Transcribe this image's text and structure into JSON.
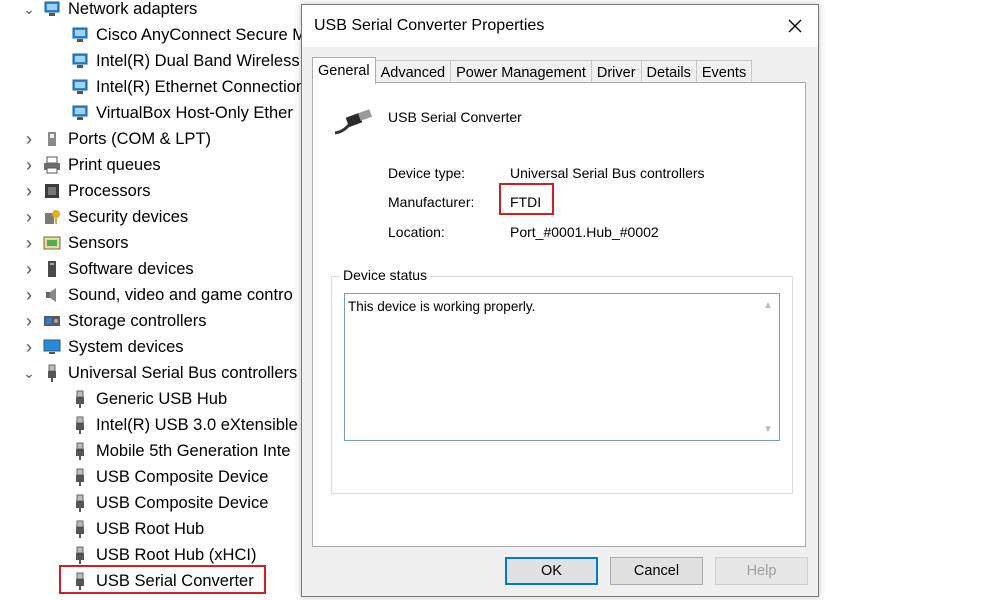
{
  "tree": {
    "items": [
      {
        "label": "Network adapters",
        "expanded": true,
        "icon": "network-adapter-icon",
        "level": 0
      },
      {
        "label": "Cisco AnyConnect Secure M",
        "icon": "network-adapter-icon",
        "level": 1
      },
      {
        "label": "Intel(R) Dual Band Wireless",
        "icon": "network-adapter-icon",
        "level": 1
      },
      {
        "label": "Intel(R) Ethernet Connection",
        "icon": "network-adapter-icon",
        "level": 1
      },
      {
        "label": "VirtualBox Host-Only Ether",
        "icon": "network-adapter-icon",
        "level": 1
      },
      {
        "label": "Ports (COM & LPT)",
        "expanded": false,
        "icon": "port-icon",
        "level": 0
      },
      {
        "label": "Print queues",
        "expanded": false,
        "icon": "printer-icon",
        "level": 0
      },
      {
        "label": "Processors",
        "expanded": false,
        "icon": "processor-icon",
        "level": 0
      },
      {
        "label": "Security devices",
        "expanded": false,
        "icon": "security-icon",
        "level": 0
      },
      {
        "label": "Sensors",
        "expanded": false,
        "icon": "sensor-icon",
        "level": 0
      },
      {
        "label": "Software devices",
        "expanded": false,
        "icon": "software-device-icon",
        "level": 0
      },
      {
        "label": "Sound, video and game contro",
        "expanded": false,
        "icon": "speaker-icon",
        "level": 0
      },
      {
        "label": "Storage controllers",
        "expanded": false,
        "icon": "storage-icon",
        "level": 0
      },
      {
        "label": "System devices",
        "expanded": false,
        "icon": "system-icon",
        "level": 0
      },
      {
        "label": "Universal Serial Bus controllers",
        "expanded": true,
        "icon": "usb-icon",
        "level": 0
      },
      {
        "label": "Generic USB Hub",
        "icon": "usb-plug-icon",
        "level": 1
      },
      {
        "label": "Intel(R) USB 3.0 eXtensible",
        "icon": "usb-plug-icon",
        "level": 1
      },
      {
        "label": "Mobile 5th Generation Inte",
        "icon": "usb-plug-icon",
        "level": 1
      },
      {
        "label": "USB Composite Device",
        "icon": "usb-plug-icon",
        "level": 1
      },
      {
        "label": "USB Composite Device",
        "icon": "usb-plug-icon",
        "level": 1
      },
      {
        "label": "USB Root Hub",
        "icon": "usb-plug-icon",
        "level": 1
      },
      {
        "label": "USB Root Hub (xHCI)",
        "icon": "usb-plug-icon",
        "level": 1
      },
      {
        "label": "USB Serial Converter",
        "icon": "usb-plug-icon",
        "level": 1,
        "selected": true
      }
    ]
  },
  "dialog": {
    "title": "USB Serial Converter Properties",
    "tabs": [
      "General",
      "Advanced",
      "Power Management",
      "Driver",
      "Details",
      "Events"
    ],
    "active_tab": "General",
    "device_name": "USB Serial Converter",
    "device_type_label": "Device type:",
    "device_type_value": "Universal Serial Bus controllers",
    "manufacturer_label": "Manufacturer:",
    "manufacturer_value": "FTDI",
    "location_label": "Location:",
    "location_value": "Port_#0001.Hub_#0002",
    "status_group_label": "Device status",
    "status_text": "This device is working properly.",
    "ok_label": "OK",
    "cancel_label": "Cancel",
    "help_label": "Help"
  },
  "colors": {
    "highlight": "#d21f26",
    "default_button_border": "#0078d7"
  }
}
